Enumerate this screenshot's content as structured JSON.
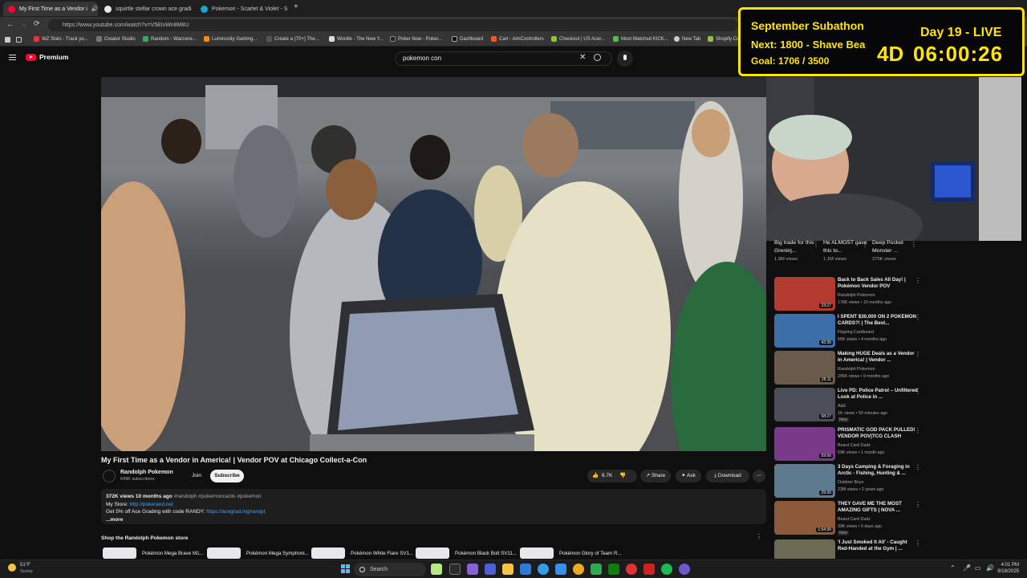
{
  "browser": {
    "tabs": [
      {
        "label": "My First Time as a Vendor i",
        "active": true,
        "color": "#ff0033"
      },
      {
        "label": "squirtle stellar crown ace gradi",
        "active": false,
        "color": "#e8e8e8"
      },
      {
        "label": "Pokemon - Scarlet & Violet - S",
        "active": false,
        "color": "#1aa6c9"
      }
    ],
    "new_tab_glyph": "+",
    "url": "https://www.youtube.com/watch?v=V5EIvWn8M8U",
    "bookmarks": [
      "WZ Stats - Track yo...",
      "Creator Studio",
      "Random - Warzone...",
      "Luminosity Gaming...",
      "Create a (70+) The...",
      "Wordle - The New Y...",
      "Poker Now - Poker...",
      "Dashboard",
      "Cart - AimControllers",
      "Checkout | US Acer...",
      "Most Watched KICK...",
      "New Tab",
      "Shopify Co"
    ]
  },
  "youtube": {
    "logo_text": "Premium",
    "search_value": "pokemon con"
  },
  "stream_overlay": {
    "title": "September Subathon",
    "next": "Next: 1800 - Shave Bea",
    "goal": "Goal: 1706 / 3500",
    "day": "Day 19 - LIVE",
    "days": "4D",
    "timer": "06:00:26",
    "accent": "#ffe600"
  },
  "video": {
    "title": "My First Time as a Vendor in America! | Vendor POV at Chicago Collect-a-Con",
    "channel": "Randolph Pokemon",
    "subscribers": "649K subscribers",
    "join_label": "Join",
    "subscribe_label": "Subscribe",
    "likes": "6.7K",
    "share_label": "Share",
    "ask_label": "Ask",
    "download_label": "Download",
    "description": {
      "meta": "372K views  10 months ago",
      "hashtags": "#randolph #pokemoncards #pokemon",
      "store_label": "My Store:",
      "store_link": "http://pokerand.net",
      "promo": "Get 5% off Ace Grading with code RANDY:",
      "promo_link": "https://acegrad.ing/randyt",
      "more": "...more"
    }
  },
  "shop": {
    "heading": "Shop the Randolph Pokemon store",
    "products": [
      "Pokémon Mega Brave M1...",
      "Pokémon Mega Symphoni...",
      "Pokémon White Flare SV1...",
      "Pokémon Black Bolt SV11...",
      "Pokémon Glory of Team R..."
    ]
  },
  "shorts": [
    {
      "title": "Big trade for this Greninj...",
      "views": "1.9M views"
    },
    {
      "title": "He ALMOST gave this to...",
      "views": "1.1M views"
    },
    {
      "title": "Deep Pocket Monster ...",
      "views": "375K views"
    }
  ],
  "recommendations": [
    {
      "title": "Back to Back Sales All Day! | Pokémon Vendor POV",
      "channel": "Randolph Pokemon",
      "meta": "178K views • 10 months ago",
      "duration": "23:27",
      "new": "",
      "color": "#b33a2e"
    },
    {
      "title": "I SPENT $30,000 ON 2 POKEMON CARDS?! | The Best...",
      "channel": "Flipping Cardboard",
      "meta": "66K views • 4 months ago",
      "duration": "42:36",
      "new": "",
      "color": "#3c6fa8"
    },
    {
      "title": "Making HUGE Deals as a Vendor in America! | Vendor ...",
      "channel": "Randolph Pokemon",
      "meta": "295K views • 9 months ago",
      "duration": "25:11",
      "new": "",
      "color": "#6a5a4c"
    },
    {
      "title": "Live PD: Police Patrol – Unfiltered Look at Police in ...",
      "channel": "A&E",
      "meta": "1K views • 50 minutes ago",
      "duration": "58:27",
      "new": "New",
      "color": "#4a4e58"
    },
    {
      "title": "PRISMATIC GOD PACK PULLED! VENDOR POV|TCG CLASH",
      "channel": "Beard Card Dadz",
      "meta": "59K views • 1 month ago",
      "duration": "59:56",
      "new": "",
      "color": "#7a3a8a"
    },
    {
      "title": "3 Days Camping & Foraging in Arctic - Fishing, Hunting & ...",
      "channel": "Outdoor Boys",
      "meta": "23M views • 2 years ago",
      "duration": "29:30",
      "new": "",
      "color": "#5d7a8e"
    },
    {
      "title": "THEY GAVE ME THE MOST AMAZING GIFTS | NOVA ...",
      "channel": "Beard Card Dadz",
      "meta": "39K views • 5 days ago",
      "duration": "1:54:30",
      "new": "New",
      "color": "#8a5a3a"
    },
    {
      "title": "'I Just Smoked It All' - Caught Red-Handed at the Gym | ...",
      "channel": "",
      "meta": "",
      "duration": "",
      "new": "",
      "color": "#6a6a55"
    }
  ],
  "taskbar": {
    "weather_temp": "51°F",
    "weather_desc": "Sunny",
    "search_label": "Search",
    "time": "4:01 PM",
    "date": "9/18/2025"
  }
}
